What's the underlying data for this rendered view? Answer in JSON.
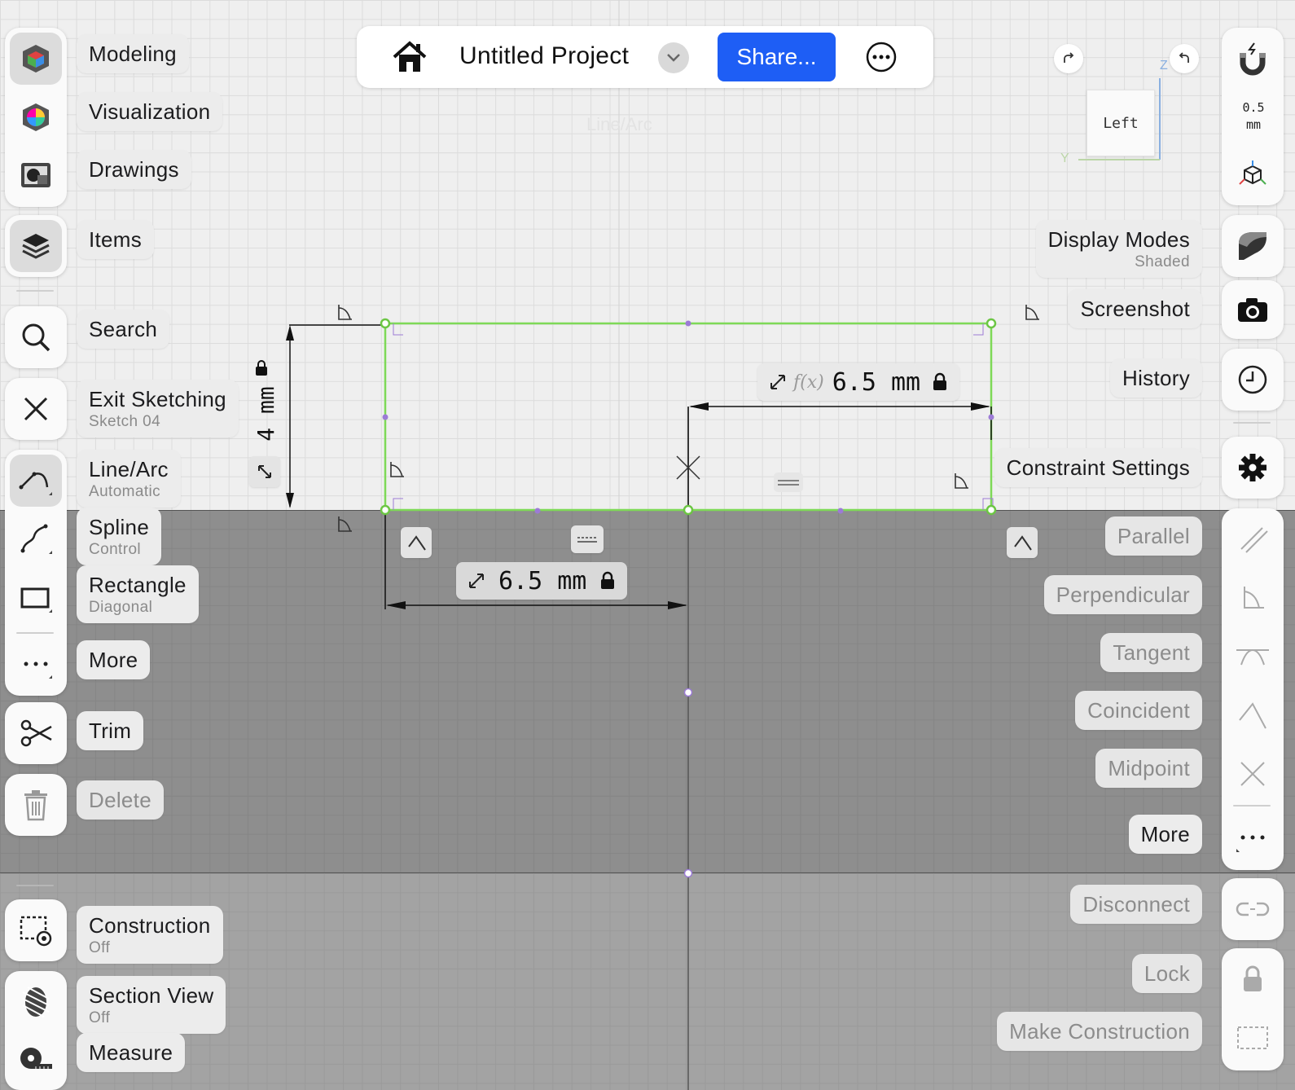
{
  "header": {
    "project_title": "Untitled Project",
    "share_label": "Share...",
    "ghost_tool": "Line/Arc"
  },
  "left_menu": {
    "modeling": "Modeling",
    "visualization": "Visualization",
    "drawings": "Drawings",
    "items": "Items",
    "search": "Search",
    "exit_sketching": "Exit Sketching",
    "sketch_name": "Sketch 04",
    "line_arc": "Line/Arc",
    "line_arc_mode": "Automatic",
    "spline": "Spline",
    "spline_mode": "Control",
    "rectangle": "Rectangle",
    "rectangle_mode": "Diagonal",
    "more": "More",
    "trim": "Trim",
    "delete": "Delete",
    "construction": "Construction",
    "construction_state": "Off",
    "section_view": "Section View",
    "section_view_state": "Off",
    "measure": "Measure"
  },
  "right_menu": {
    "view_cube_face": "Left",
    "axis_z": "Z",
    "axis_y": "Y",
    "snap_value": "0.5",
    "snap_unit": "mm",
    "display_modes": "Display Modes",
    "display_mode_value": "Shaded",
    "screenshot": "Screenshot",
    "history": "History",
    "constraint_settings": "Constraint Settings",
    "parallel": "Parallel",
    "perpendicular": "Perpendicular",
    "tangent": "Tangent",
    "coincident": "Coincident",
    "midpoint": "Midpoint",
    "more": "More",
    "disconnect": "Disconnect",
    "lock": "Lock",
    "make_construction": "Make Construction"
  },
  "dimensions": {
    "height": "4 mm",
    "upper_width": "6.5 mm",
    "upper_fx": "f(x)",
    "lower_width": "6.5 mm"
  },
  "colors": {
    "accent": "#1e5ef5",
    "sketch_line": "#7ed957",
    "midpoint": "#9c7bd6"
  }
}
